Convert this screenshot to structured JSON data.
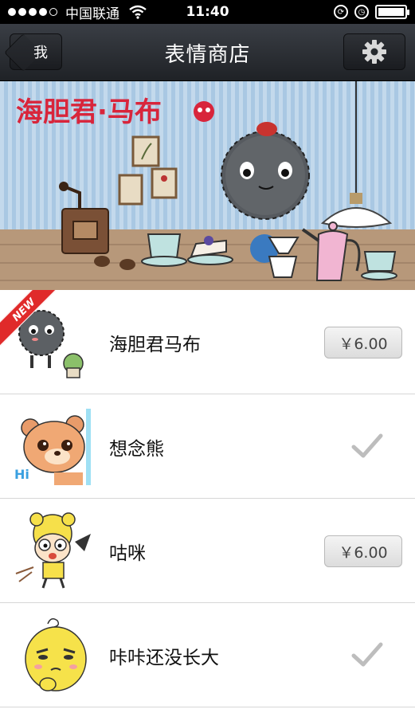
{
  "status_bar": {
    "carrier": "中国联通",
    "time": "11:40",
    "battery_level": 1.0
  },
  "nav": {
    "back_label": "我",
    "title": "表情商店",
    "settings_icon": "gear-icon"
  },
  "banner": {
    "title": "海胆君·马布",
    "theme_colors": {
      "wall": "#a7c7e2",
      "floor": "#b89a7c",
      "title_red": "#d8253b"
    }
  },
  "items": [
    {
      "name": "海胆君马布",
      "price": "￥6.00",
      "is_new": true,
      "new_label": "NEW",
      "purchased": false
    },
    {
      "name": "想念熊",
      "price": "",
      "is_new": false,
      "purchased": true,
      "thumb_text": "Hi"
    },
    {
      "name": "咕咪",
      "price": "￥6.00",
      "is_new": false,
      "purchased": false
    },
    {
      "name": "咔咔还没长大",
      "price": "",
      "is_new": false,
      "purchased": true
    }
  ]
}
